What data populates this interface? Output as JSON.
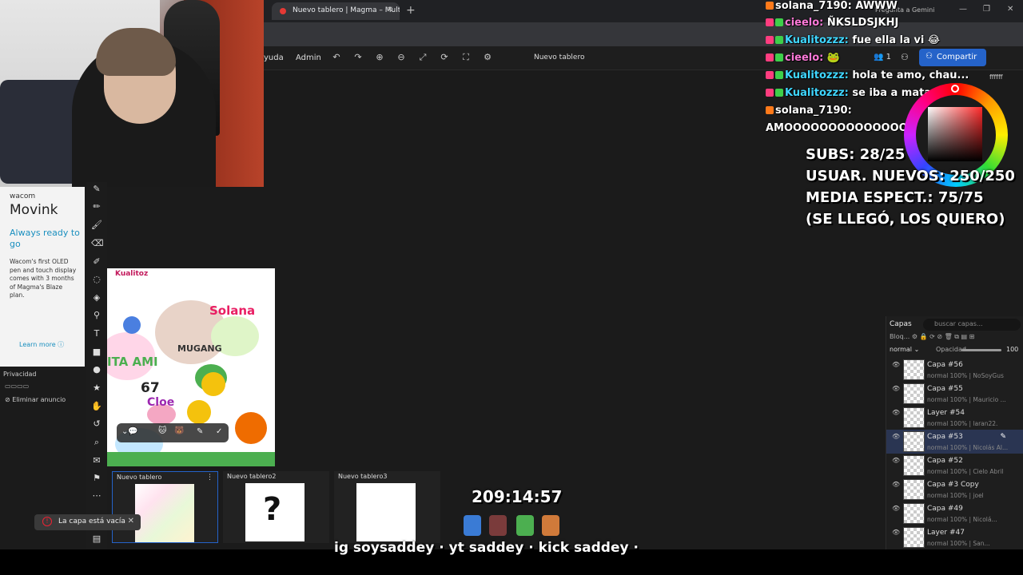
{
  "browser": {
    "tab_title": "Nuevo tablero | Magma – Multi",
    "gemini_label": "Pregunta a Gemini"
  },
  "app": {
    "menu_help": "yuda",
    "menu_admin": "Admin",
    "board_title": "Nuevo tablero",
    "share_label": "Compartir",
    "users_count": "1",
    "color_hex": "ffffff"
  },
  "ad": {
    "brand": "wacom",
    "product": "Movink",
    "headline": "Always ready to go",
    "body": "Wacom's first OLED pen and touch display comes with 3 months of Magma's Blaze plan.",
    "learn_more": "Learn more"
  },
  "privacy": {
    "label": "Privacidad",
    "remove_ad": "Eliminar anuncio"
  },
  "chat": [
    {
      "user": "solana_7190:",
      "text": "AWWW",
      "badges": [
        "orange"
      ]
    },
    {
      "user": "cieelo:",
      "text": "ÑKSLDSJKHJ",
      "badges": [
        "pink",
        "green"
      ]
    },
    {
      "user": "Kualitozzz:",
      "text": "fue ella la vi 😂",
      "badges": [
        "pink",
        "green"
      ]
    },
    {
      "user": "cieelo:",
      "text": "🐸",
      "badges": [
        "pink",
        "green"
      ]
    },
    {
      "user": "Kualitozzz:",
      "text": "hola te amo, chau...",
      "badges": [
        "pink",
        "green"
      ]
    },
    {
      "user": "Kualitozzz:",
      "text": "se iba a matar",
      "badges": [
        "pink",
        "green"
      ]
    },
    {
      "user": "solana_7190:",
      "text": "",
      "badges": [
        "orange"
      ]
    },
    {
      "user": "",
      "text": "AMOOOOOOOOOOOOOOOOOO",
      "badges": []
    }
  ],
  "subs_overlay": {
    "line1": "SUBS: 28/25",
    "line2": "USUAR. NUEVOS: 250/250",
    "line3": "MEDIA ESPECT.: 75/75",
    "line4": "(SE LLEGÓ, LOS QUIERO)"
  },
  "layers": {
    "title": "Capas",
    "search_placeholder": "buscar capas...",
    "lock_label": "Bloq...",
    "blend_mode": "normal",
    "opacity_label": "Opacidad",
    "opacity_value": "100",
    "items": [
      {
        "name": "Capa #56",
        "sub": "normal 100% | NoSoyGus",
        "selected": false
      },
      {
        "name": "Capa #55",
        "sub": "normal 100% | Mauricio ...",
        "selected": false
      },
      {
        "name": "Layer #54",
        "sub": "normal 100% | laran22.",
        "selected": false
      },
      {
        "name": "Capa #53",
        "sub": "normal 100% | Nicolás Al...",
        "selected": true
      },
      {
        "name": "Capa #52",
        "sub": "normal 100% | Cielo Abril",
        "selected": false
      },
      {
        "name": "Capa #3 Copy",
        "sub": "normal 100% | joel",
        "selected": false
      },
      {
        "name": "Capa #49",
        "sub": "normal 100% | Nicolá...",
        "selected": false
      },
      {
        "name": "Layer #47",
        "sub": "normal 100% | San...",
        "selected": false
      }
    ]
  },
  "boards": [
    {
      "name": "Nuevo tablero",
      "selected": true
    },
    {
      "name": "Nuevo tablero2",
      "selected": false
    },
    {
      "name": "Nuevo tablero3",
      "selected": false
    }
  ],
  "timer": "209:14:57",
  "toast": "La capa está vacía",
  "ticker": "ig soysaddey · yt saddey · kick saddey ·",
  "canvas_words": [
    "Kualitoz",
    "MUGANG",
    "Solana",
    "ITA AMI",
    "67",
    "Cloe"
  ],
  "colors": {
    "accent": "#2563c9",
    "selected_layer": "#2a3552",
    "error": "#e23"
  }
}
